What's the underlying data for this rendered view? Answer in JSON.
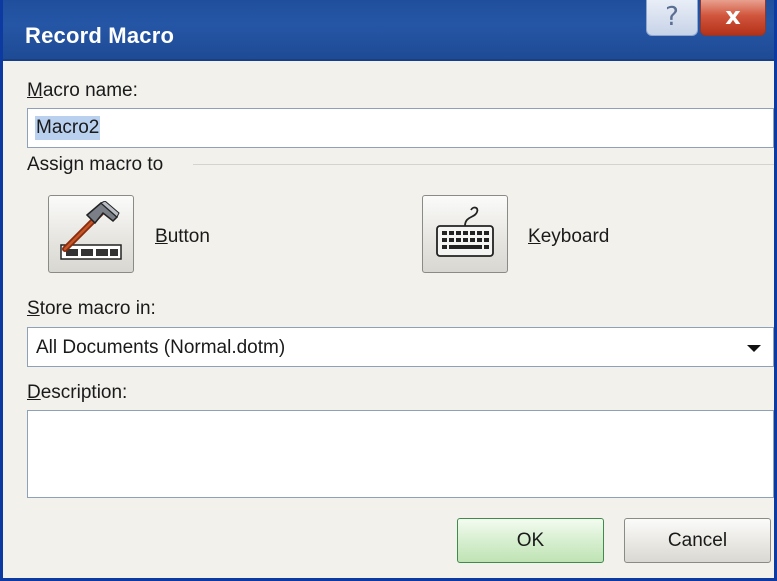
{
  "window": {
    "title": "Record Macro",
    "help_glyph": "?",
    "close_glyph": "x"
  },
  "macro_name": {
    "label_underlined": "M",
    "label_rest": "acro name:",
    "value": "Macro2"
  },
  "assign": {
    "label": "Assign macro to",
    "button": {
      "icon": "hammer-icon",
      "label_underlined": "B",
      "label_rest": "utton"
    },
    "keyboard": {
      "icon": "keyboard-icon",
      "label_underlined": "K",
      "label_rest": "eyboard"
    }
  },
  "store": {
    "label_underlined": "S",
    "label_rest": "tore macro in:",
    "selected": "All Documents (Normal.dotm)"
  },
  "description": {
    "label_underlined": "D",
    "label_rest": "escription:",
    "value": ""
  },
  "buttons": {
    "ok": "OK",
    "cancel": "Cancel"
  },
  "colors": {
    "titlebar": "#2556a6",
    "window_bg": "#f2f1ec",
    "ok_border": "#3f8a4c",
    "selection": "#b9d0ee"
  }
}
